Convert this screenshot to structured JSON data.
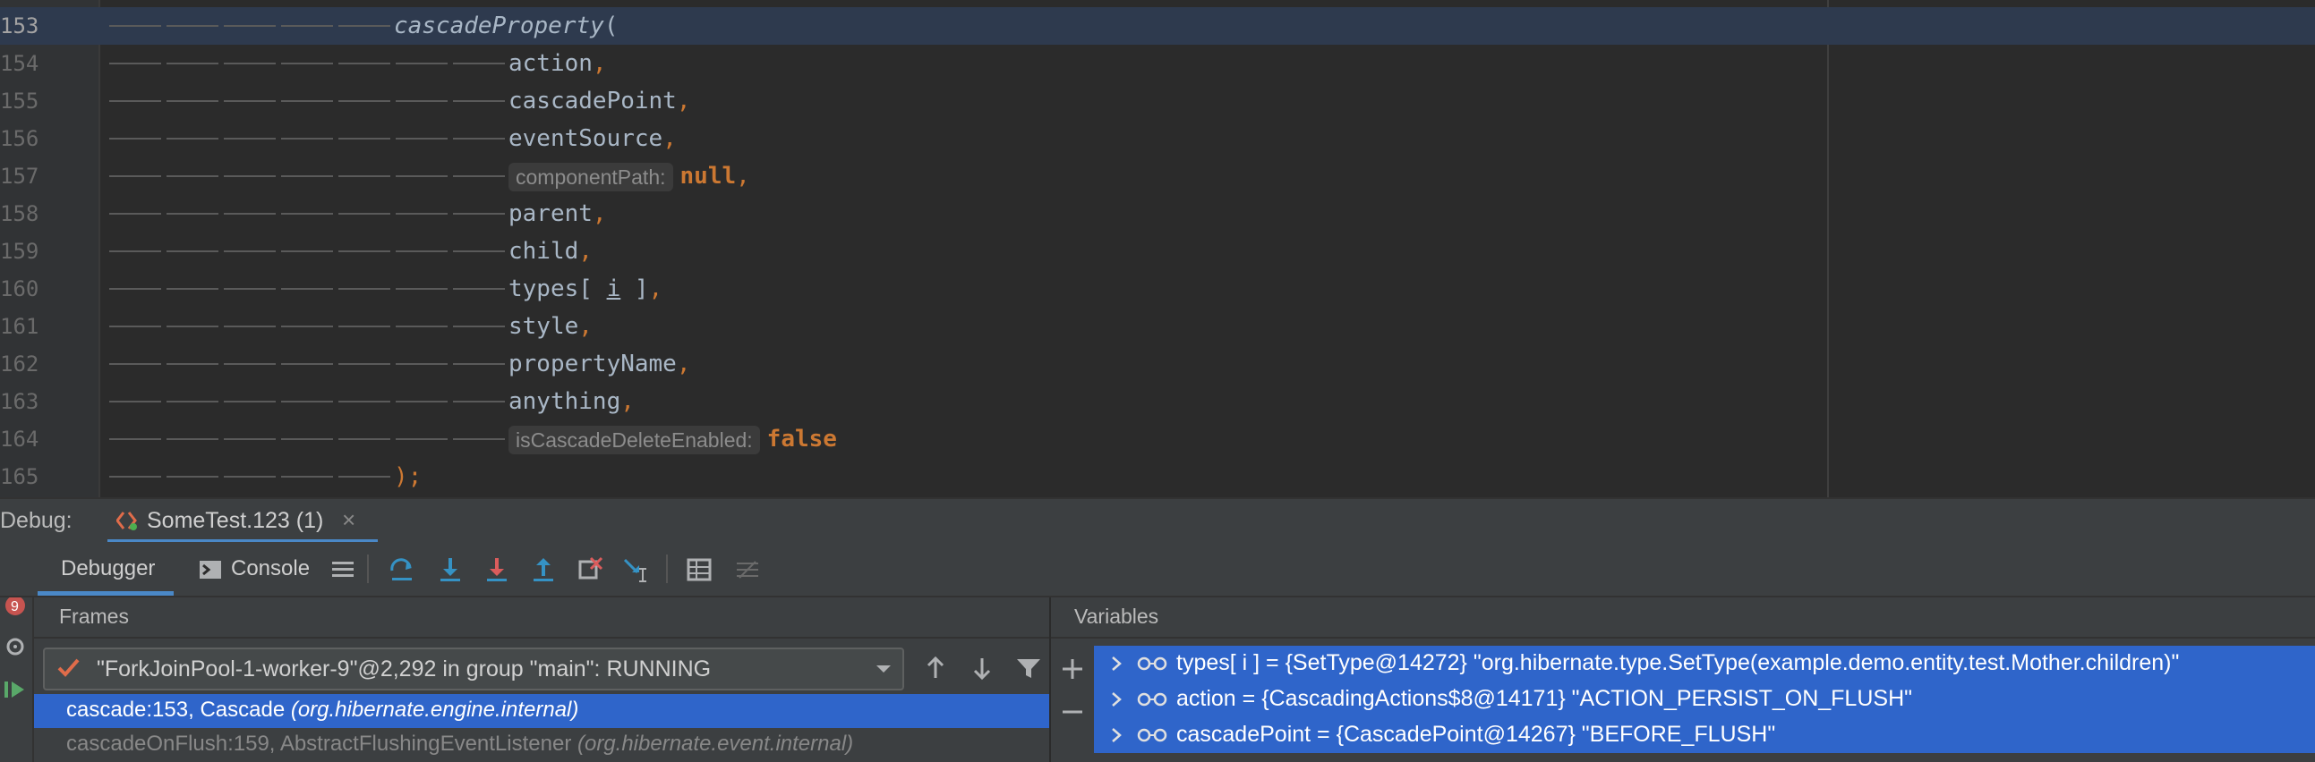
{
  "editor": {
    "lines": [
      {
        "no": "153",
        "segments": [
          {
            "t": "cascadeProperty",
            "c": "fn"
          },
          {
            "t": "(",
            "c": ""
          }
        ],
        "indent": 5,
        "current": true
      },
      {
        "no": "154",
        "segments": [
          {
            "t": "action",
            "c": ""
          },
          {
            "t": ",",
            "c": "comma"
          }
        ],
        "indent": 7
      },
      {
        "no": "155",
        "segments": [
          {
            "t": "cascadePoint",
            "c": ""
          },
          {
            "t": ",",
            "c": "comma"
          }
        ],
        "indent": 7
      },
      {
        "no": "156",
        "segments": [
          {
            "t": "eventSource",
            "c": ""
          },
          {
            "t": ",",
            "c": "comma"
          }
        ],
        "indent": 7
      },
      {
        "no": "157",
        "hint": "componentPath:",
        "segments": [
          {
            "t": "null",
            "c": "kw"
          },
          {
            "t": ",",
            "c": "comma"
          }
        ],
        "indent": 7
      },
      {
        "no": "158",
        "segments": [
          {
            "t": "parent",
            "c": ""
          },
          {
            "t": ",",
            "c": "comma"
          }
        ],
        "indent": 7
      },
      {
        "no": "159",
        "segments": [
          {
            "t": "child",
            "c": ""
          },
          {
            "t": ",",
            "c": "comma"
          }
        ],
        "indent": 7
      },
      {
        "no": "160",
        "segments": [
          {
            "t": "types[ ",
            "c": ""
          },
          {
            "t": "i",
            "c": "under"
          },
          {
            "t": " ]",
            "c": ""
          },
          {
            "t": ",",
            "c": "comma"
          }
        ],
        "indent": 7
      },
      {
        "no": "161",
        "segments": [
          {
            "t": "style",
            "c": ""
          },
          {
            "t": ",",
            "c": "comma"
          }
        ],
        "indent": 7
      },
      {
        "no": "162",
        "segments": [
          {
            "t": "propertyName",
            "c": ""
          },
          {
            "t": ",",
            "c": "comma"
          }
        ],
        "indent": 7
      },
      {
        "no": "163",
        "segments": [
          {
            "t": "anything",
            "c": ""
          },
          {
            "t": ",",
            "c": "comma"
          }
        ],
        "indent": 7
      },
      {
        "no": "164",
        "hint": "isCascadeDeleteEnabled:",
        "segments": [
          {
            "t": "false",
            "c": "kw"
          }
        ],
        "indent": 7
      },
      {
        "no": "165",
        "segments": [
          {
            "t": ");",
            "c": "comma"
          }
        ],
        "indent": 5
      }
    ]
  },
  "debug": {
    "label": "Debug:",
    "session_tab": "SomeTest.123 (1)",
    "close_glyph": "×"
  },
  "toolbar": {
    "debugger_label": "Debugger",
    "console_label": "Console"
  },
  "frames": {
    "title": "Frames",
    "thread": "\"ForkJoinPool-1-worker-9\"@2,292 in group \"main\": RUNNING",
    "items": [
      {
        "method": "cascade:153, Cascade ",
        "pkg": "(org.hibernate.engine.internal)",
        "selected": true
      },
      {
        "method": "cascadeOnFlush:159, AbstractFlushingEventListener ",
        "pkg": "(org.hibernate.event.internal)",
        "selected": false
      }
    ]
  },
  "variables": {
    "title": "Variables",
    "items": [
      {
        "text": "types[ i ] = {SetType@14272} \"org.hibernate.type.SetType(example.demo.entity.test.Mother.children)\""
      },
      {
        "text": "action = {CascadingActions$8@14171} \"ACTION_PERSIST_ON_FLUSH\""
      },
      {
        "text": "cascadePoint = {CascadePoint@14267} \"BEFORE_FLUSH\""
      }
    ]
  },
  "colors": {
    "selection": "#2f65ca",
    "accent_underline": "#4a88c7",
    "keyword": "#cc7832"
  }
}
